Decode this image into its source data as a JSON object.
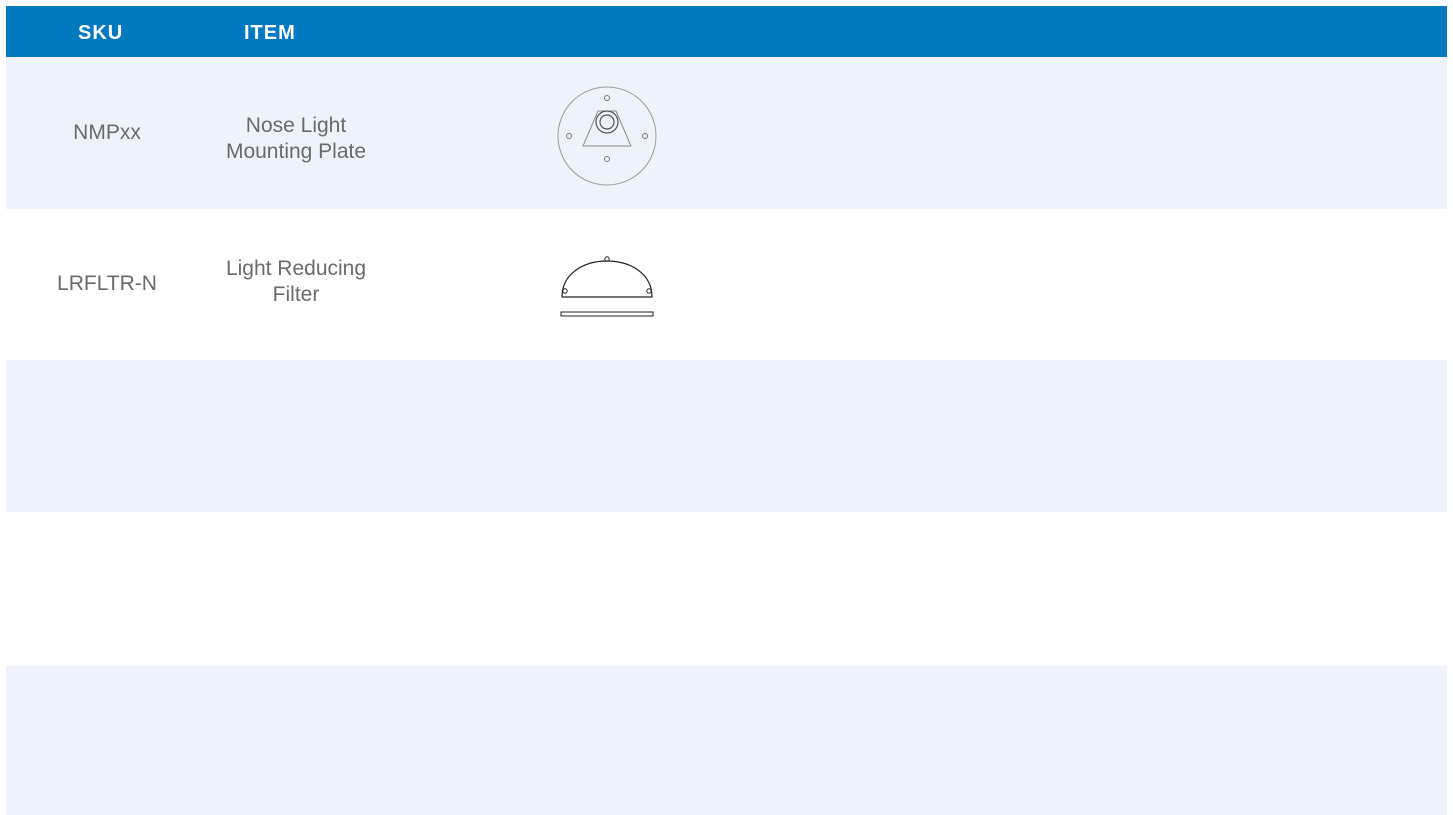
{
  "table": {
    "header": {
      "sku": "SKU",
      "item": "ITEM"
    },
    "rows": [
      {
        "sku": "NMPxx",
        "item_line1": "Nose Light",
        "item_line2": "Mounting Plate",
        "image_icon": "mounting-plate-drawing"
      },
      {
        "sku": "LRFLTR-N",
        "item_line1": "Light Reducing",
        "item_line2": "Filter",
        "image_icon": "light-filter-drawing"
      },
      {
        "sku": "",
        "item_line1": "",
        "item_line2": ""
      },
      {
        "sku": "",
        "item_line1": "",
        "item_line2": ""
      },
      {
        "sku": "",
        "item_line1": "",
        "item_line2": ""
      }
    ]
  },
  "colors": {
    "header_bg": "#0079c1",
    "row_alt_bg": "#eef3fb",
    "text": "#6a6a6a"
  }
}
